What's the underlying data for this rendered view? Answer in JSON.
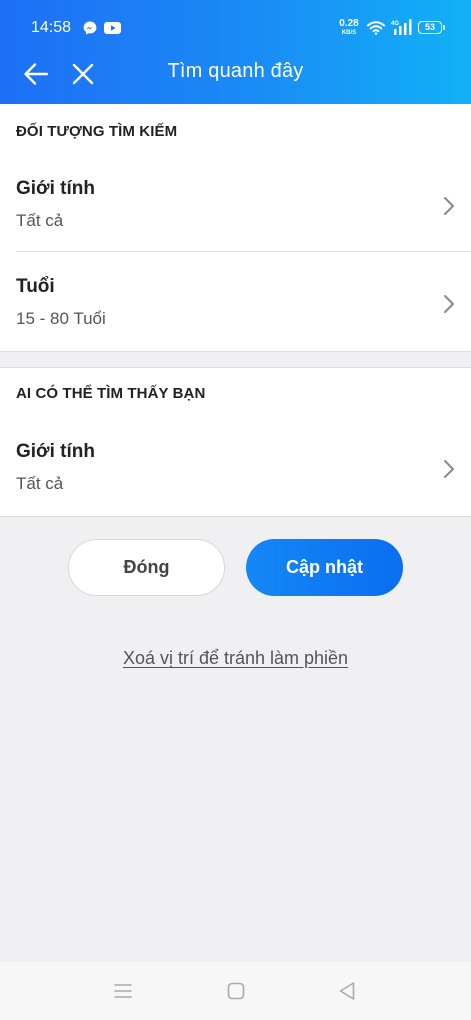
{
  "status_bar": {
    "time": "14:58",
    "net_speed_value": "0.28",
    "net_speed_unit": "KB/S",
    "network_type": "4G",
    "battery": "53"
  },
  "header": {
    "title": "Tìm quanh đây",
    "back_icon": "arrow-left-icon",
    "close_icon": "close-icon"
  },
  "search_target": {
    "header": "ĐỐI TƯỢNG TÌM KIẾM",
    "rows": [
      {
        "title": "Giới tính",
        "value": "Tất cả"
      },
      {
        "title": "Tuổi",
        "value": "15 - 80 Tuổi"
      }
    ]
  },
  "who_can_find": {
    "header": "AI CÓ THỂ TÌM THẤY BẠN",
    "rows": [
      {
        "title": "Giới tính",
        "value": "Tất cả"
      }
    ]
  },
  "actions": {
    "close_label": "Đóng",
    "update_label": "Cập nhật"
  },
  "clear_location_link": "Xoá vị trí để tránh làm phiền",
  "colors": {
    "header_gradient_start": "#1d6ff5",
    "header_gradient_end": "#12b1f7",
    "primary_button": "#0a6ef0",
    "background": "#f0f0f2"
  }
}
